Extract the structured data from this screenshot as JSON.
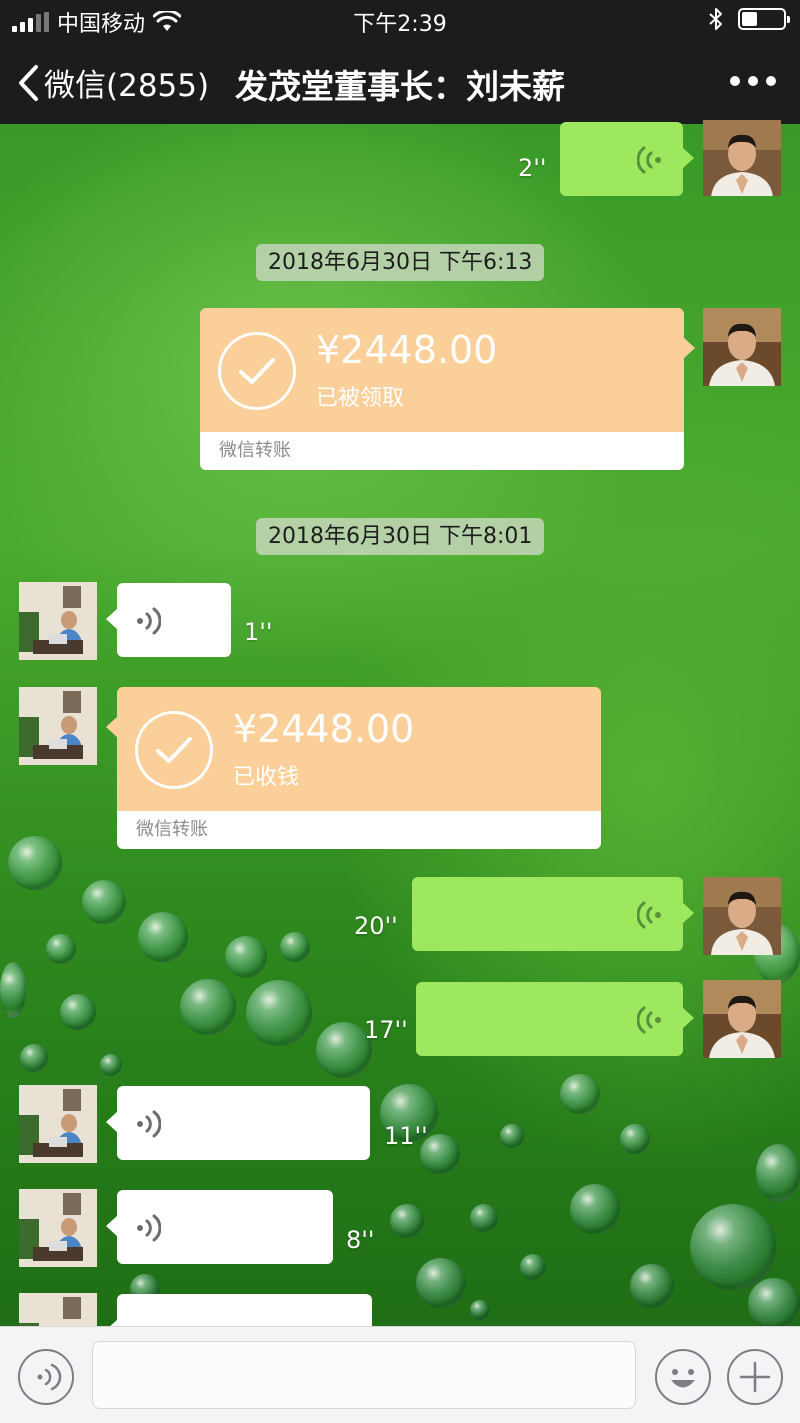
{
  "status_bar": {
    "carrier": "中国移动",
    "time": "下午2:39",
    "battery_level": 0.38
  },
  "nav": {
    "back_label": "微信(2855)",
    "title": "发茂堂董事长：刘未薪"
  },
  "messages": {
    "voice_1": {
      "duration": "2''"
    },
    "timestamp_1": "2018年6月30日 下午6:13",
    "transfer_1": {
      "amount": "¥2448.00",
      "status": "已被领取",
      "footer": "微信转账"
    },
    "timestamp_2": "2018年6月30日 下午8:01",
    "voice_2": {
      "duration": "1''"
    },
    "transfer_2": {
      "amount": "¥2448.00",
      "status": "已收钱",
      "footer": "微信转账"
    },
    "voice_3": {
      "duration": "20''"
    },
    "voice_4": {
      "duration": "17''"
    },
    "voice_5": {
      "duration": "11''"
    },
    "voice_6": {
      "duration": "8''"
    }
  },
  "input": {
    "placeholder": ""
  },
  "colors": {
    "outgoing_bubble": "#9de85e",
    "incoming_bubble": "#ffffff",
    "transfer": "#fbcf9a",
    "nav_bg": "#1a1d1c"
  }
}
